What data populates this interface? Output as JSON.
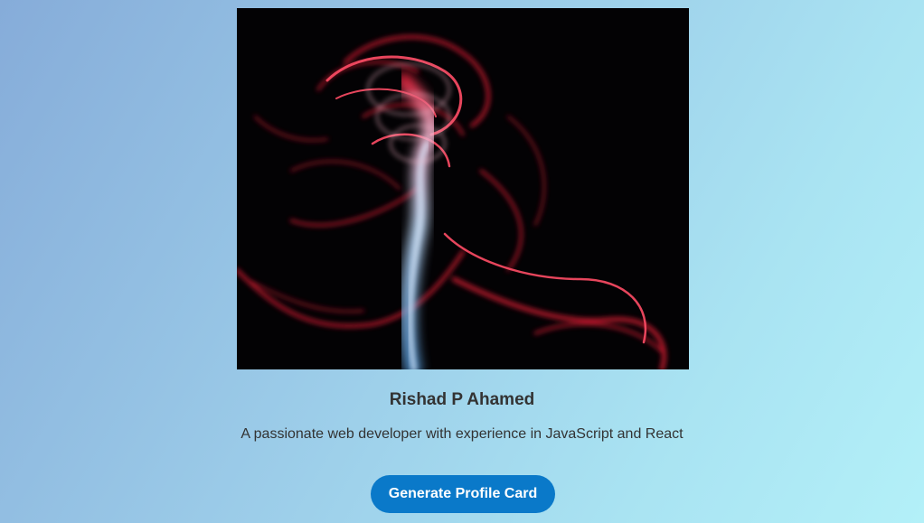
{
  "profile": {
    "name": "Rishad P Ahamed",
    "bio": "A passionate web developer with experience in JavaScript and React",
    "photo": "abstract red and blue smoke on black background"
  },
  "actions": {
    "generate_label": "Generate Profile Card"
  },
  "colors": {
    "button": "#0a79c9",
    "text": "#333333",
    "smoke_red": "#e0203a",
    "smoke_blue": "#7fb8e8"
  }
}
